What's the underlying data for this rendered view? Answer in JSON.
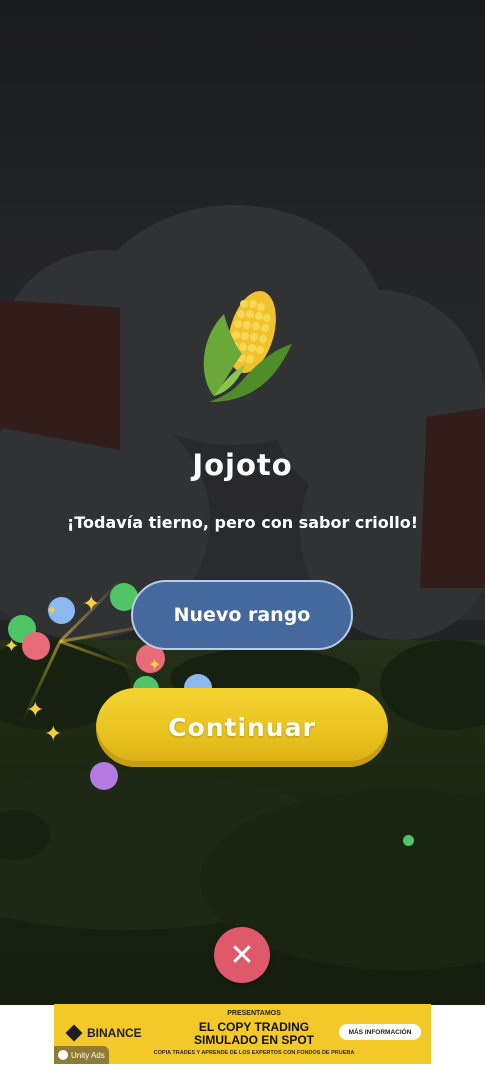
{
  "reward": {
    "icon": "corn-icon",
    "title": "Jojoto",
    "subtitle": "¡Todavía tierno, pero con sabor criollo!"
  },
  "buttons": {
    "rank_label": "Nuevo rango",
    "continue_label": "Continuar",
    "close_icon": "close-icon",
    "close_glyph": "✕"
  },
  "colors": {
    "rank_button": "#45699c",
    "continue_button": "#e8c21e",
    "close_button": "#de5a6a"
  },
  "ad": {
    "brand": "BINANCE",
    "kicker": "PRESENTAMOS",
    "headline_1": "EL COPY TRADING",
    "headline_2": "SIMULADO EN SPOT",
    "footnote": "COPIA TRADES Y APRENDE DE LOS EXPERTOS CON FONDOS DE PRUEBA",
    "cta": "MÁS INFORMACIÓN",
    "network": "Unity Ads",
    "background_color": "#f3c92a"
  }
}
